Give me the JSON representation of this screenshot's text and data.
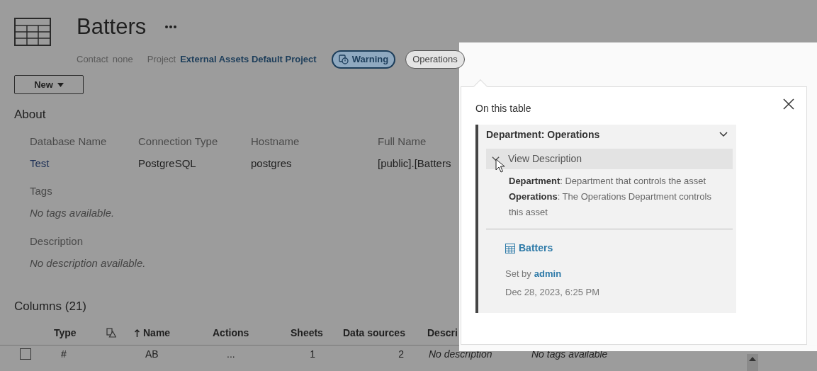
{
  "title": "Batters",
  "meta": {
    "contact_label": "Contact",
    "contact_value": "none",
    "project_label": "Project",
    "project_value": "External Assets Default Project"
  },
  "badges": [
    {
      "label": "Warning",
      "kind": "warning"
    },
    {
      "label": "Operations",
      "kind": "category"
    }
  ],
  "new_button": "New",
  "about": {
    "heading": "About",
    "fields": [
      {
        "label": "Database Name",
        "value": "Test",
        "kind": "link"
      },
      {
        "label": "Connection Type",
        "value": "PostgreSQL",
        "kind": "text"
      },
      {
        "label": "Hostname",
        "value": "postgres",
        "kind": "text"
      },
      {
        "label": "Full Name",
        "value": "[public].[Batters",
        "kind": "text"
      }
    ],
    "tags_label": "Tags",
    "tags_empty": "No tags available.",
    "description_label": "Description",
    "description_empty": "No description available."
  },
  "columns": {
    "heading": "Columns (21)",
    "headers": [
      {
        "label": "Type",
        "kind": "text"
      },
      {
        "kind": "icon"
      },
      {
        "label": "Name",
        "kind": "sorted"
      },
      {
        "label": "Actions",
        "kind": "text"
      },
      {
        "label": "Sheets",
        "kind": "text"
      },
      {
        "label": "Data sources",
        "kind": "text"
      },
      {
        "label": "Descri",
        "kind": "text"
      }
    ],
    "rows": [
      {
        "checked": false,
        "cells": [
          "#",
          "AB",
          "...",
          "1",
          "2",
          "No description",
          "No tags available"
        ]
      }
    ]
  },
  "popover": {
    "heading": "On this table",
    "card": {
      "title": "Department: Operations",
      "expanded": true,
      "toggle_label": "View Description",
      "toggle_expanded": true,
      "descriptions": [
        "**Department**: Department that controls the asset",
        "**Operations**: The Operations Department controls this asset"
      ],
      "asset": "Batters",
      "set_by_label": "Set by",
      "set_by_user": "admin",
      "date": "Dec 28, 2023, 6:25 PM"
    }
  }
}
